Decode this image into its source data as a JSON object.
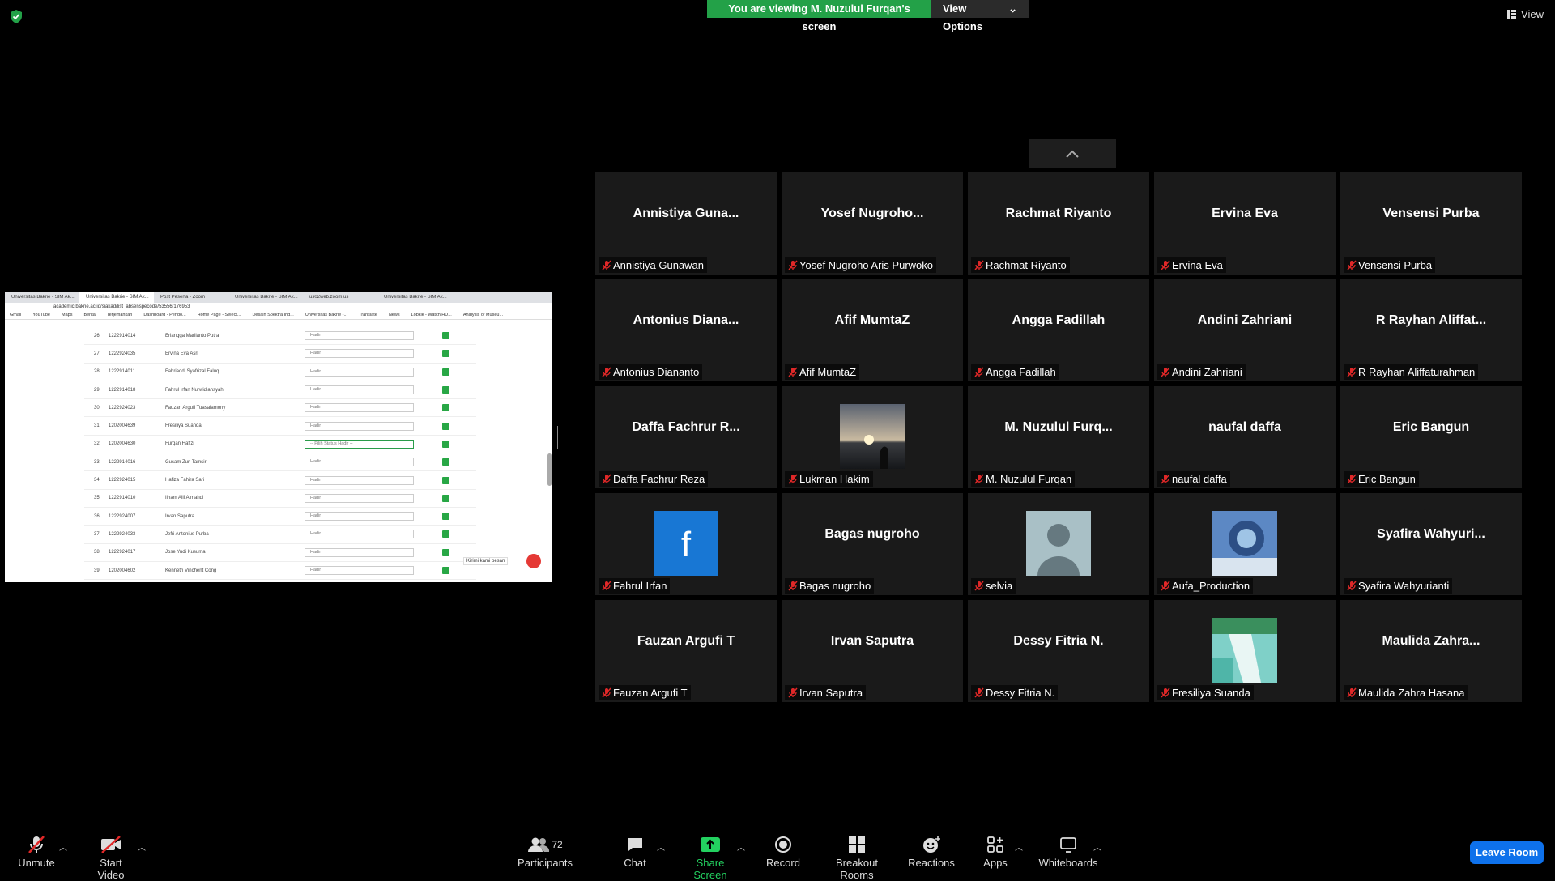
{
  "banner": {
    "viewing": "You are viewing M. Nuzulul Furqan's screen",
    "view_options": "View Options"
  },
  "view_label": "View",
  "tiles": [
    {
      "big": "Annistiya  Guna...",
      "name": "Annistiya Gunawan"
    },
    {
      "big": "Yosef  Nugroho...",
      "name": "Yosef Nugroho Aris Purwoko"
    },
    {
      "big": "Rachmat Riyanto",
      "name": "Rachmat Riyanto"
    },
    {
      "big": "Ervina Eva",
      "name": "Ervina Eva"
    },
    {
      "big": "Vensensi Purba",
      "name": "Vensensi Purba"
    },
    {
      "big": "Antonius  Diana...",
      "name": "Antonius Diananto"
    },
    {
      "big": "Afif MumtaZ",
      "name": "Afif MumtaZ"
    },
    {
      "big": "Angga Fadillah",
      "name": "Angga Fadillah"
    },
    {
      "big": "Andini Zahriani",
      "name": "Andini Zahriani"
    },
    {
      "big": "R Rayhan  Aliffat...",
      "name": "R Rayhan Aliffaturahman"
    },
    {
      "big": "Daffa Fachrur R...",
      "name": "Daffa Fachrur Reza"
    },
    {
      "big": "",
      "name": "Lukman Hakim",
      "pic": "sunset"
    },
    {
      "big": "M.  Nuzulul Furq...",
      "name": "M. Nuzulul Furqan"
    },
    {
      "big": "naufal daffa",
      "name": "naufal daffa"
    },
    {
      "big": "Eric Bangun",
      "name": "Eric Bangun"
    },
    {
      "big": "",
      "name": "Fahrul Irfan",
      "pic": "facebook"
    },
    {
      "big": "Bagas nugroho",
      "name": "Bagas nugroho"
    },
    {
      "big": "",
      "name": "selvia",
      "pic": "avatar"
    },
    {
      "big": "",
      "name": "Aufa_Production",
      "pic": "art"
    },
    {
      "big": "Syafira  Wahyuri...",
      "name": "Syafira Wahyurianti"
    },
    {
      "big": "Fauzan Argufi T",
      "name": "Fauzan Argufi T"
    },
    {
      "big": "Irvan Saputra",
      "name": "Irvan Saputra"
    },
    {
      "big": "Dessy Fitria N.",
      "name": "Dessy Fitria N."
    },
    {
      "big": "",
      "name": "Fresiliya Suanda",
      "pic": "waterfall"
    },
    {
      "big": "Maulida  Zahra...",
      "name": "Maulida Zahra Hasana"
    }
  ],
  "shared": {
    "tabs": [
      "Universitas Bakrie - SIM Ak...",
      "Universitas Bakrie - SIM Ak...",
      "Post Peserta - Zoom",
      "Universitas Bakrie - SIM Ak...",
      "us02web.zoom.us",
      "Universitas Bakrie - SIM Ak..."
    ],
    "url": "academic.bakrie.ac.id/siakad/list_absenspecode/53556/176953",
    "bookmarks": [
      "Gmail",
      "YouTube",
      "Maps",
      "Berita",
      "Terjemahkan",
      "Dashboard - Pendo...",
      "Home Page - Select...",
      "Desain Spektra Ind...",
      "Universitas Bakrie -...",
      "Translate",
      "News",
      "Lobkik - Watch HD...",
      "Analysis of Museu..."
    ],
    "rows": [
      {
        "no": "26",
        "nim": "1222914014",
        "nama": "Erlangga Marlianto Putra",
        "status": "Hadir"
      },
      {
        "no": "27",
        "nim": "1222924035",
        "nama": "Ervina Eva Asri",
        "status": "Hadir"
      },
      {
        "no": "28",
        "nim": "1222914011",
        "nama": "Fahriaddi Syafrizal Faluq",
        "status": "Hadir"
      },
      {
        "no": "29",
        "nim": "1222914018",
        "nama": "Fahrul Irfan Nurwidiansyah",
        "status": "Hadir"
      },
      {
        "no": "30",
        "nim": "1222924023",
        "nama": "Fauzan Argufi Tuasalamony",
        "status": "Hadir"
      },
      {
        "no": "31",
        "nim": "1202004639",
        "nama": "Fresiliya Suanda",
        "status": "Hadir"
      },
      {
        "no": "32",
        "nim": "1202004630",
        "nama": "Furqan Hafizi",
        "status": "-- Pilih Status Hadir --"
      },
      {
        "no": "33",
        "nim": "1222914016",
        "nama": "Gusam Zuri Tamsir",
        "status": "Hadir"
      },
      {
        "no": "34",
        "nim": "1222924015",
        "nama": "Hafiza Fahira Sari",
        "status": "Hadir"
      },
      {
        "no": "35",
        "nim": "1222914010",
        "nama": "Ilham Alif Almahdi",
        "status": "Hadir"
      },
      {
        "no": "36",
        "nim": "1222924007",
        "nama": "Irvan Saputra",
        "status": "Hadir"
      },
      {
        "no": "37",
        "nim": "1222924033",
        "nama": "Jefri Antonius Purba",
        "status": "Hadir"
      },
      {
        "no": "38",
        "nim": "1222924017",
        "nama": "Jose Yudi Kusuma",
        "status": "Hadir"
      },
      {
        "no": "39",
        "nim": "1202004602",
        "nama": "Kenneth Vinchent Cong",
        "status": "Hadir"
      }
    ],
    "chat_label": "Kirimi kami pesan"
  },
  "toolbar": {
    "unmute": "Unmute",
    "start_video": "Start Video",
    "participants": "Participants",
    "participants_count": "72",
    "chat": "Chat",
    "share_screen": "Share Screen",
    "record": "Record",
    "breakout": "Breakout Rooms",
    "reactions": "Reactions",
    "apps": "Apps",
    "whiteboards": "Whiteboards",
    "leave": "Leave Room"
  }
}
